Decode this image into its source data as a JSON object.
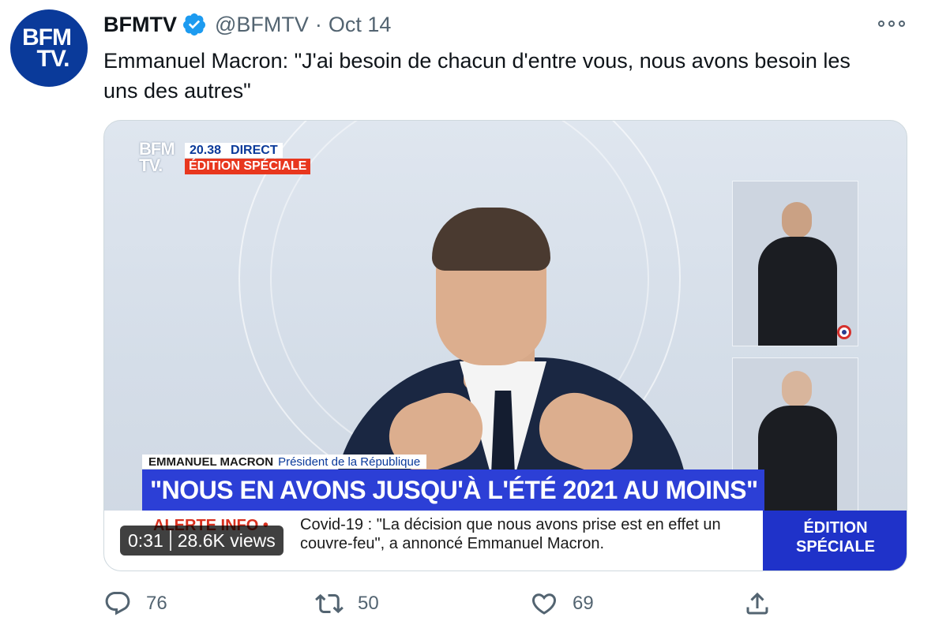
{
  "tweet": {
    "avatar_text_1": "BFM",
    "avatar_text_2": "TV.",
    "author_name": "BFMTV",
    "handle": "@BFMTV",
    "separator": "·",
    "date": "Oct 14",
    "text": "Emmanuel Macron: \"J'ai besoin de chacun d'entre vous, nous avons besoin les uns des autres\""
  },
  "video": {
    "logo_line_1": "BFM",
    "logo_line_2": "TV.",
    "time": "20.38",
    "live_label": "DIRECT",
    "edition_label": "ÉDITION SPÉCIALE",
    "speaker_name": "EMMANUEL MACRON",
    "speaker_role": "Président de la République",
    "headline": "\"NOUS EN AVONS JUSQU'À L'ÉTÉ 2021 AU MOINS\"",
    "alert_label": "ALERTE INFO •",
    "ticker_text": "Covid-19 : \"La décision que nous avons prise est en effet un couvre-feu\", a annoncé Emmanuel Macron.",
    "corner_line_1": "ÉDITION",
    "corner_line_2": "SPÉCIALE",
    "duration": "0:31",
    "views": "28.6K views"
  },
  "actions": {
    "reply_count": "76",
    "retweet_count": "50",
    "like_count": "69"
  },
  "colors": {
    "verified_blue": "#1d9bf0",
    "bfm_blue": "#0a3a9a",
    "headline_blue": "#2c3fd6",
    "alert_red": "#d8301f",
    "secondary_text": "#536471"
  }
}
